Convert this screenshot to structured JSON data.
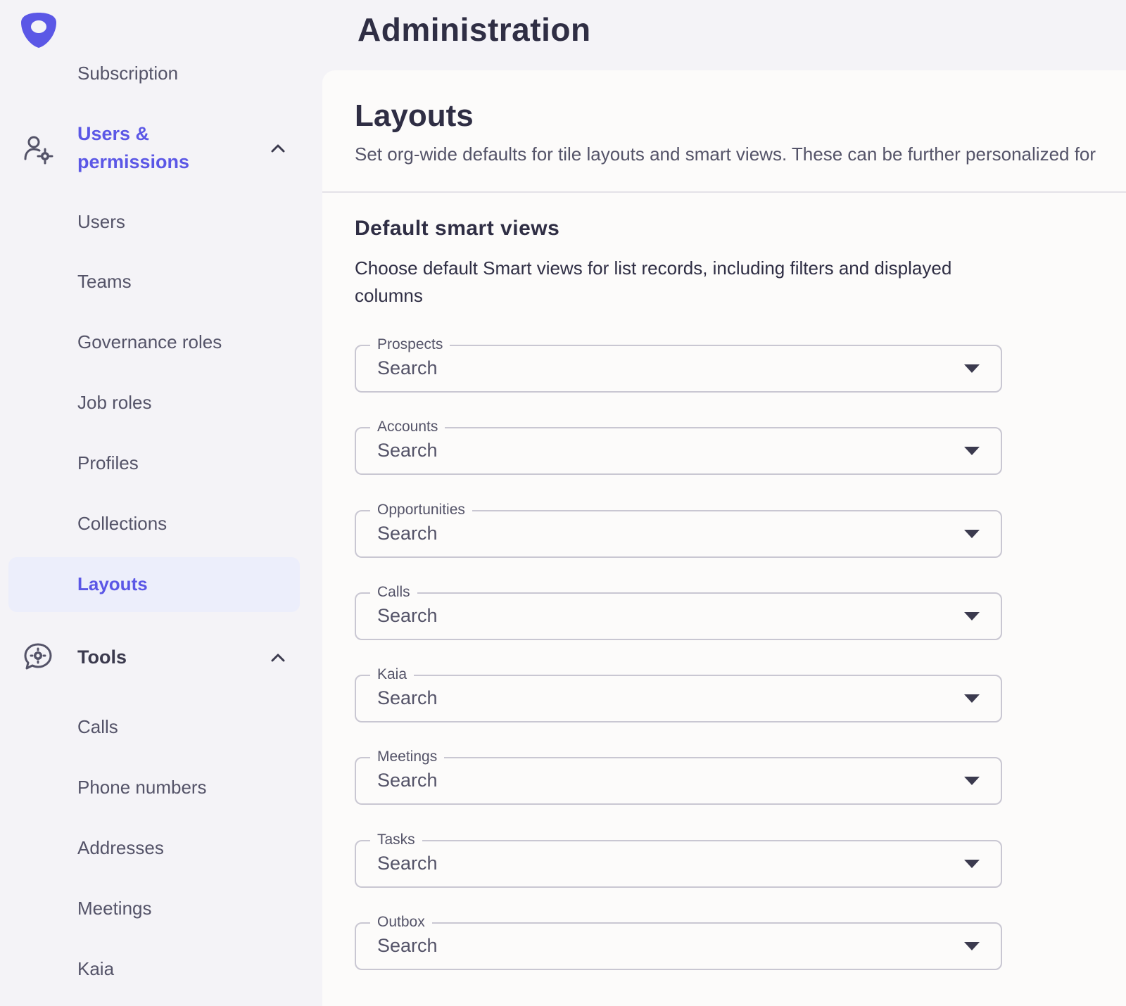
{
  "colors": {
    "accent": "#5b57e6",
    "sidebar_bg": "#f4f3f7",
    "card_bg": "#fcfbfa",
    "active_bg": "#eceefb"
  },
  "header": {
    "title": "Administration"
  },
  "sidebar": {
    "logo_icon": "shield-logo-icon",
    "clipped_item": "Subscription",
    "users_group": {
      "icon": "user-gear-icon",
      "label_line1": "Users &",
      "label_line2": "permissions",
      "items": [
        "Users",
        "Teams",
        "Governance roles",
        "Job roles",
        "Profiles",
        "Collections",
        "Layouts"
      ],
      "active_item": "Layouts"
    },
    "tools_group": {
      "icon": "chat-gear-icon",
      "label": "Tools",
      "items": [
        "Calls",
        "Phone numbers",
        "Addresses",
        "Meetings",
        "Kaia"
      ]
    }
  },
  "main": {
    "title": "Layouts",
    "description": "Set org-wide defaults for tile layouts and smart views. These can be further personalized for",
    "section": {
      "title": "Default smart views",
      "description": "Choose default Smart views for list records, including filters and displayed columns",
      "fields": [
        {
          "label": "Prospects",
          "value": "Search"
        },
        {
          "label": "Accounts",
          "value": "Search"
        },
        {
          "label": "Opportunities",
          "value": "Search"
        },
        {
          "label": "Calls",
          "value": "Search"
        },
        {
          "label": "Kaia",
          "value": "Search"
        },
        {
          "label": "Meetings",
          "value": "Search"
        },
        {
          "label": "Tasks",
          "value": "Search"
        },
        {
          "label": "Outbox",
          "value": "Search"
        }
      ]
    }
  }
}
